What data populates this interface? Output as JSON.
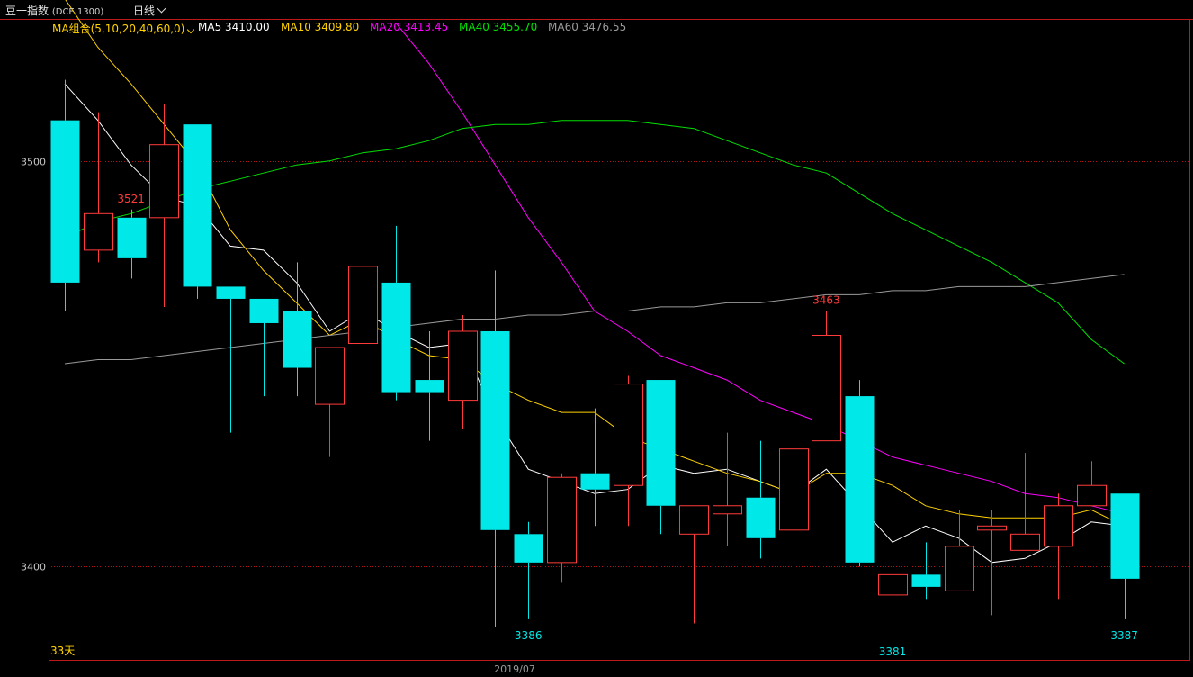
{
  "header": {
    "symbol_name": "豆一指数",
    "symbol_code": "(DCE 1300)",
    "period": "日线"
  },
  "legend": {
    "group_label": "MA组合(5,10,20,40,60,0)",
    "items": [
      {
        "label": "MA5 3410.00",
        "color": "#ffffff"
      },
      {
        "label": "MA10 3409.80",
        "color": "#ffd200"
      },
      {
        "label": "MA20 3413.45",
        "color": "#ff00ff"
      },
      {
        "label": "MA40 3455.70",
        "color": "#00e000"
      },
      {
        "label": "MA60 3476.55",
        "color": "#9a9a9a"
      }
    ]
  },
  "footer": {
    "days_label": "33天",
    "date_label": "2019/07"
  },
  "colors": {
    "up": "#ff3b3b",
    "down": "#00e8e8",
    "frame": "#c01818",
    "grid": "#b01010",
    "axis_text": "#c8c8c8"
  },
  "chart_data": {
    "type": "candlestick",
    "ylim": [
      3377,
      3535
    ],
    "y_ticks": [
      3400,
      3500
    ],
    "annotations": [
      {
        "text": "3521",
        "index": 2,
        "value": 3521,
        "position": "above"
      },
      {
        "text": "3463",
        "index": 23,
        "value": 3463,
        "position": "above"
      },
      {
        "text": "3386",
        "index": 14,
        "value": 3386,
        "position": "below"
      },
      {
        "text": "3381",
        "index": 25,
        "value": 3381,
        "position": "below"
      },
      {
        "text": "3387",
        "index": 32,
        "value": 3387,
        "position": "below"
      }
    ],
    "candles": [
      {
        "open": 3510,
        "close": 3470,
        "high": 3520,
        "low": 3463
      },
      {
        "open": 3478,
        "close": 3487,
        "high": 3512,
        "low": 3475
      },
      {
        "open": 3486,
        "close": 3476,
        "high": 3488,
        "low": 3471
      },
      {
        "open": 3486,
        "close": 3504,
        "high": 3514,
        "low": 3464
      },
      {
        "open": 3509,
        "close": 3469,
        "high": 3509,
        "low": 3466
      },
      {
        "open": 3469,
        "close": 3466,
        "high": 3469,
        "low": 3433
      },
      {
        "open": 3466,
        "close": 3460,
        "high": 3466,
        "low": 3442
      },
      {
        "open": 3463,
        "close": 3449,
        "high": 3475,
        "low": 3442
      },
      {
        "open": 3440,
        "close": 3454,
        "high": 3454,
        "low": 3427
      },
      {
        "open": 3455,
        "close": 3474,
        "high": 3486,
        "low": 3451
      },
      {
        "open": 3470,
        "close": 3443,
        "high": 3484,
        "low": 3441
      },
      {
        "open": 3446,
        "close": 3443,
        "high": 3458,
        "low": 3431
      },
      {
        "open": 3441,
        "close": 3458,
        "high": 3462,
        "low": 3434
      },
      {
        "open": 3458,
        "close": 3409,
        "high": 3473,
        "low": 3385
      },
      {
        "open": 3408,
        "close": 3401,
        "high": 3411,
        "low": 3387
      },
      {
        "open": 3401,
        "close": 3422,
        "high": 3423,
        "low": 3396
      },
      {
        "open": 3423,
        "close": 3419,
        "high": 3439,
        "low": 3410
      },
      {
        "open": 3420,
        "close": 3445,
        "high": 3447,
        "low": 3410
      },
      {
        "open": 3446,
        "close": 3415,
        "high": 3446,
        "low": 3408
      },
      {
        "open": 3408,
        "close": 3415,
        "high": 3415,
        "low": 3386
      },
      {
        "open": 3413,
        "close": 3415,
        "high": 3433,
        "low": 3405
      },
      {
        "open": 3417,
        "close": 3407,
        "high": 3431,
        "low": 3402
      },
      {
        "open": 3409,
        "close": 3429,
        "high": 3439,
        "low": 3395
      },
      {
        "open": 3431,
        "close": 3457,
        "high": 3463,
        "low": 3431
      },
      {
        "open": 3442,
        "close": 3401,
        "high": 3446,
        "low": 3400
      },
      {
        "open": 3393,
        "close": 3398,
        "high": 3406,
        "low": 3383
      },
      {
        "open": 3398,
        "close": 3395,
        "high": 3406,
        "low": 3392
      },
      {
        "open": 3394,
        "close": 3405,
        "high": 3414,
        "low": 3394
      },
      {
        "open": 3409,
        "close": 3410,
        "high": 3414,
        "low": 3388
      },
      {
        "open": 3404,
        "close": 3408,
        "high": 3428,
        "low": 3406
      },
      {
        "open": 3405,
        "close": 3415,
        "high": 3418,
        "low": 3392
      },
      {
        "open": 3415,
        "close": 3420,
        "high": 3426,
        "low": 3415
      },
      {
        "open": 3418,
        "close": 3397,
        "high": 3418,
        "low": 3387
      }
    ],
    "series": [
      {
        "name": "MA5",
        "color": "#ffffff",
        "values": [
          3519,
          3510,
          3499,
          3491,
          3489,
          3479,
          3478,
          3470,
          3458,
          3463,
          3458,
          3454,
          3455,
          3437,
          3424,
          3421,
          3418,
          3419,
          3425,
          3423,
          3424,
          3421,
          3418,
          3424,
          3415,
          3406,
          3410,
          3407,
          3401,
          3402,
          3406,
          3411,
          3410
        ]
      },
      {
        "name": "MA10",
        "color": "#ffd200",
        "values": [
          3540,
          3528,
          3519,
          3509,
          3499,
          3483,
          3473,
          3465,
          3457,
          3461,
          3456,
          3452,
          3451,
          3445,
          3441,
          3438,
          3438,
          3432,
          3429,
          3426,
          3423,
          3421,
          3418,
          3423,
          3423,
          3420,
          3415,
          3413,
          3412,
          3412,
          3412,
          3414,
          3410
        ]
      },
      {
        "name": "MA20",
        "color": "#ff00ff",
        "values": [
          null,
          null,
          null,
          null,
          null,
          null,
          null,
          null,
          null,
          null,
          3534,
          3524,
          3512,
          3499,
          3486,
          3475,
          3463,
          3458,
          3452,
          3449,
          3446,
          3441,
          3438,
          3435,
          3431,
          3427,
          3425,
          3423,
          3421,
          3418,
          3417,
          3415,
          3413
        ]
      },
      {
        "name": "MA40",
        "color": "#00e000",
        "values": [
          3481,
          3485,
          3487,
          3490,
          3493,
          3495,
          3497,
          3499,
          3500,
          3502,
          3503,
          3505,
          3508,
          3509,
          3509,
          3510,
          3510,
          3510,
          3509,
          3508,
          3505,
          3502,
          3499,
          3497,
          3492,
          3487,
          3483,
          3479,
          3475,
          3470,
          3465,
          3456,
          3450
        ]
      },
      {
        "name": "MA60",
        "color": "#9a9a9a",
        "values": [
          3450,
          3451,
          3451,
          3452,
          3453,
          3454,
          3455,
          3456,
          3457,
          3458,
          3459,
          3460,
          3461,
          3461,
          3462,
          3462,
          3463,
          3463,
          3464,
          3464,
          3465,
          3465,
          3466,
          3467,
          3467,
          3468,
          3468,
          3469,
          3469,
          3469,
          3470,
          3471,
          3472
        ]
      }
    ]
  }
}
